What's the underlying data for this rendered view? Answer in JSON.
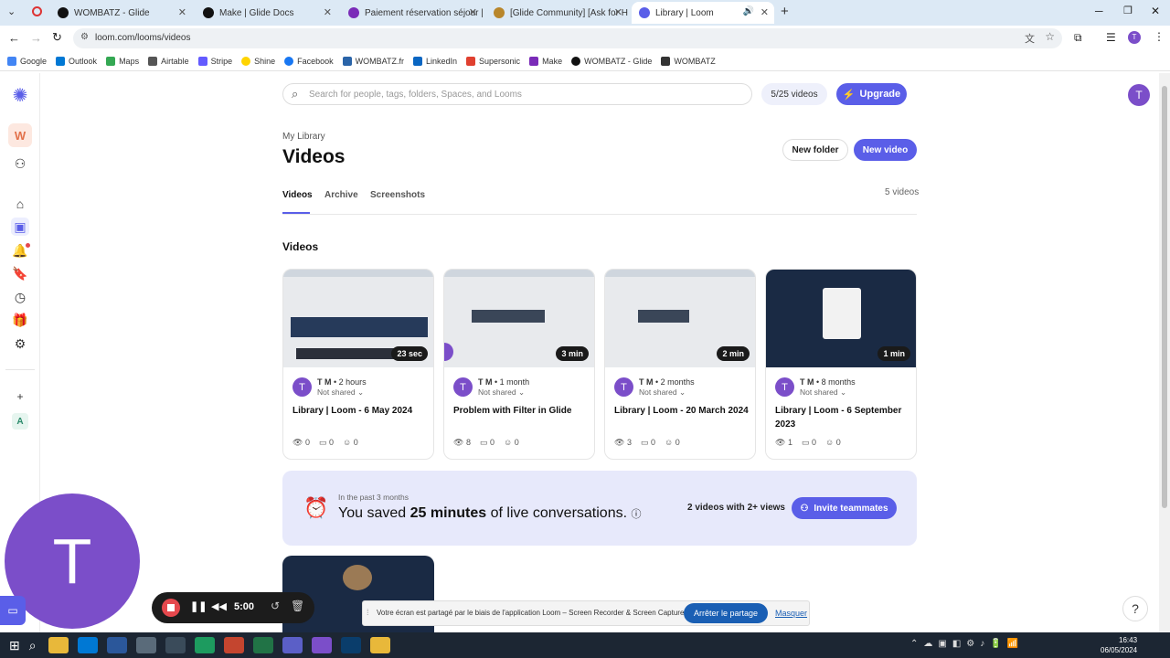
{
  "browser": {
    "tabs": [
      {
        "label": "WOMBATZ - Glide",
        "color": "#111"
      },
      {
        "label": "Make | Glide Docs",
        "color": "#111"
      },
      {
        "label": "Paiement réservation séjour | M",
        "color": "#7a2bb8"
      },
      {
        "label": "[Glide Community] [Ask for He",
        "color": "#b8862b"
      },
      {
        "label": "Library | Loom",
        "color": "#5a5ee8"
      }
    ],
    "url": "loom.com/looms/videos",
    "bookmarks": [
      {
        "label": "Google",
        "color": "#4285f4"
      },
      {
        "label": "Outlook",
        "color": "#0078d4"
      },
      {
        "label": "Maps",
        "color": "#34a853"
      },
      {
        "label": "Airtable",
        "color": "#555"
      },
      {
        "label": "Stripe",
        "color": "#635bff"
      },
      {
        "label": "Shine",
        "color": "#ffd400"
      },
      {
        "label": "Facebook",
        "color": "#1877f2"
      },
      {
        "label": "WOMBATZ.fr",
        "color": "#2a64a8"
      },
      {
        "label": "LinkedIn",
        "color": "#0a66c2"
      },
      {
        "label": "Supersonic",
        "color": "#e04030"
      },
      {
        "label": "Make",
        "color": "#7a2bb8"
      },
      {
        "label": "WOMBATZ - Glide",
        "color": "#111"
      },
      {
        "label": "WOMBATZ",
        "color": "#333"
      }
    ]
  },
  "sidebar": {
    "workspace_letter": "W",
    "workspace_initial": "A"
  },
  "header": {
    "search_placeholder": "Search for people, tags, folders, Spaces, and Looms",
    "video_count": "5/25 videos",
    "upgrade_label": "Upgrade",
    "user_initial": "T"
  },
  "library": {
    "breadcrumb": "My Library",
    "title": "Videos",
    "new_folder": "New folder",
    "new_video": "New video",
    "tabs": [
      "Videos",
      "Archive",
      "Screenshots"
    ],
    "total": "5 videos",
    "section_title": "Videos"
  },
  "videos": [
    {
      "duration": "23 sec",
      "author": "T M",
      "age": "2 hours",
      "sharing": "Not shared",
      "title": "Library | Loom - 6 May 2024",
      "views": "0",
      "comments": "0",
      "reactions": "0"
    },
    {
      "duration": "3 min",
      "author": "T M",
      "age": "1 month",
      "sharing": "Not shared",
      "title": "Problem with Filter in Glide",
      "views": "8",
      "comments": "0",
      "reactions": "0"
    },
    {
      "duration": "2 min",
      "author": "T M",
      "age": "2 months",
      "sharing": "Not shared",
      "title": "Library | Loom - 20 March 2024",
      "views": "3",
      "comments": "0",
      "reactions": "0"
    },
    {
      "duration": "1 min",
      "author": "T M",
      "age": "8 months",
      "sharing": "Not shared",
      "title": "Library | Loom - 6 September 2023",
      "views": "1",
      "comments": "0",
      "reactions": "0"
    }
  ],
  "banner": {
    "eyebrow": "In the past 3 months",
    "text_before": "You saved ",
    "text_bold": "25 minutes",
    "text_after": " of live conversations.",
    "stat": "2 videos with 2+ views",
    "invite": "Invite teammates"
  },
  "recorder": {
    "avatar_letter": "T",
    "time": "5:00"
  },
  "share_bar": {
    "message": "Votre écran est partagé par le biais de l'application Loom – Screen Recorder & Screen Capture.",
    "stop": "Arrêter le partage",
    "hide": "Masquer"
  },
  "taskbar": {
    "time": "16:43",
    "date": "06/05/2024"
  },
  "help_label": "?"
}
